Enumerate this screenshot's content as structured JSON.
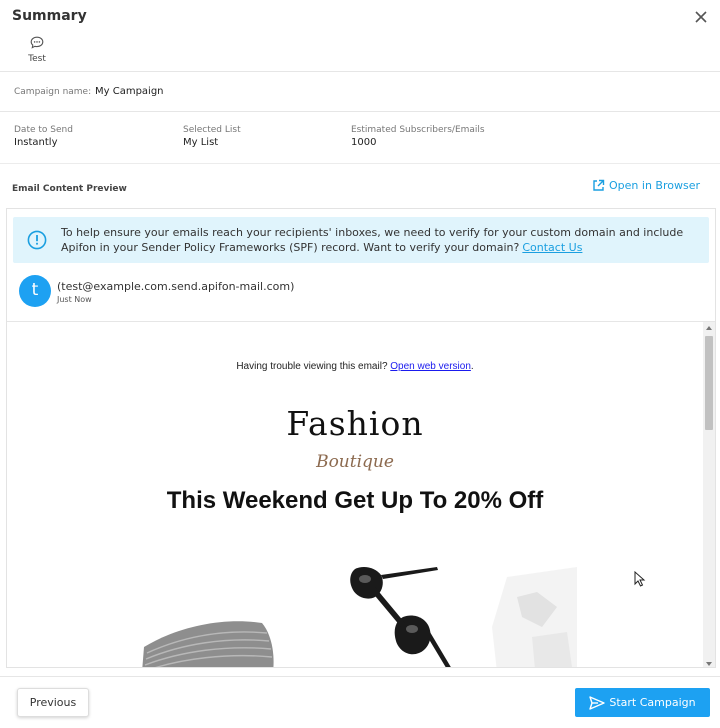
{
  "header": {
    "title": "Summary",
    "channel_label": "Test",
    "channel_icon": "chat-bubble-icon",
    "close_icon": "close-icon"
  },
  "campaign": {
    "name_label": "Campaign name:",
    "name_value": "My Campaign"
  },
  "info": {
    "date_label": "Date to Send",
    "date_value": "Instantly",
    "list_label": "Selected List",
    "list_value": "My List",
    "subs_label": "Estimated Subscribers/Emails",
    "subs_value": "1000"
  },
  "preview": {
    "heading": "Email Content Preview",
    "open_browser": "Open in Browser",
    "notice_text": "To help ensure your emails reach your recipients' inboxes, we need to verify for your custom domain and include Apifon in your Sender Policy Frameworks (SPF) record. Want to verify your domain?",
    "notice_link": "Contact Us",
    "sender_initial": "t",
    "sender_email": "(test@example.com.send.apifon-mail.com)",
    "sender_time": "Just Now"
  },
  "email": {
    "trouble_text": "Having trouble viewing this email?",
    "trouble_link": "Open web version",
    "trouble_end": ".",
    "brand": "Fashion",
    "brand_script": "Boutique",
    "headline": "This Weekend Get Up To 20% Off"
  },
  "footer": {
    "previous": "Previous",
    "start": "Start Campaign"
  },
  "colors": {
    "accent": "#1da1f2",
    "link": "#1a9fe0",
    "notice_bg": "#e0f4fc"
  }
}
